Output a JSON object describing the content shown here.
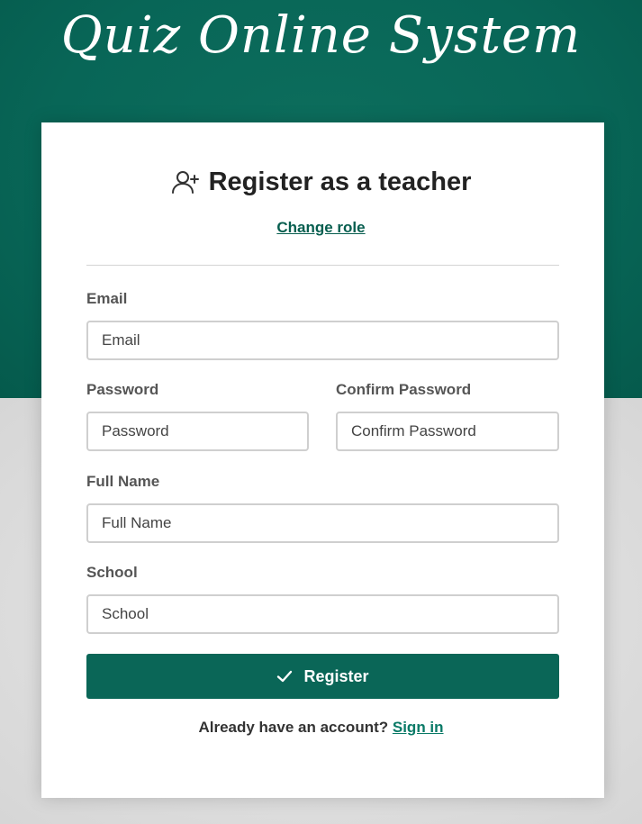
{
  "app": {
    "title": "Quiz Online System"
  },
  "form": {
    "heading": "Register as a teacher",
    "heading_icon": "user-plus-icon",
    "change_role_label": "Change role",
    "email": {
      "label": "Email",
      "placeholder": "Email",
      "value": ""
    },
    "password": {
      "label": "Password",
      "placeholder": "Password",
      "value": ""
    },
    "confirm_password": {
      "label": "Confirm Password",
      "placeholder": "Confirm Password",
      "value": ""
    },
    "full_name": {
      "label": "Full Name",
      "placeholder": "Full Name",
      "value": ""
    },
    "school": {
      "label": "School",
      "placeholder": "School",
      "value": ""
    },
    "register_button": {
      "label": "Register",
      "icon": "check-icon"
    },
    "footer": {
      "prompt": "Already have an account?",
      "sign_in_label": "Sign in"
    }
  },
  "colors": {
    "brand_green": "#086657",
    "button_green": "#0a6657",
    "link_green": "#075e4f",
    "background_gray": "#d9d9d9",
    "card_white": "#ffffff"
  }
}
